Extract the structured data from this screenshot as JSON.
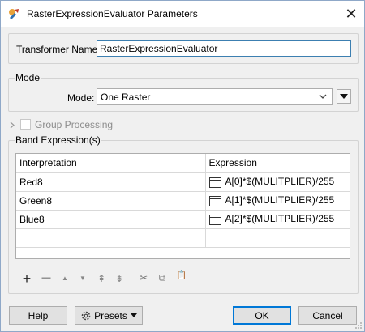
{
  "window": {
    "title": "RasterExpressionEvaluator Parameters"
  },
  "transformer": {
    "label": "Transformer Name:",
    "value": "RasterExpressionEvaluator"
  },
  "mode_section": {
    "title": "Mode",
    "label": "Mode:",
    "value": "One Raster"
  },
  "group_processing": {
    "label": "Group Processing"
  },
  "band_section": {
    "title": "Band Expression(s)",
    "columns": [
      "Interpretation",
      "Expression"
    ],
    "rows": [
      {
        "interpretation": "Red8",
        "expression": "A[0]*$(MULITPLIER)/255"
      },
      {
        "interpretation": "Green8",
        "expression": "A[1]*$(MULITPLIER)/255"
      },
      {
        "interpretation": "Blue8",
        "expression": "A[2]*$(MULITPLIER)/255"
      }
    ]
  },
  "toolbar": {
    "add": "+",
    "remove": "—",
    "up": "▲",
    "down": "▼",
    "top": "⇞",
    "bottom": "⇟",
    "cut": "✂",
    "copy": "⧉",
    "paste": "📋"
  },
  "buttons": {
    "help": "Help",
    "presets": "Presets",
    "ok": "OK",
    "cancel": "Cancel"
  }
}
